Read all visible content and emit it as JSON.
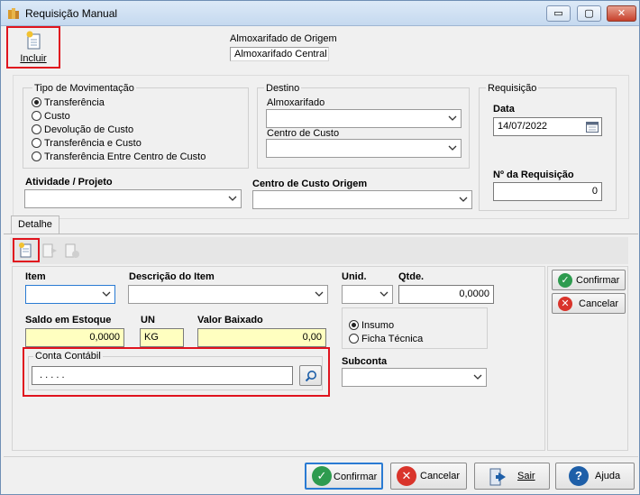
{
  "window": {
    "title": "Requisição Manual",
    "controls": {
      "minimize": "▭",
      "maximize": "▢",
      "close": "✕"
    }
  },
  "toolbar": {
    "incluir_label": "Incluir"
  },
  "origem": {
    "label": "Almoxarifado de Origem",
    "value": "Almoxarifado Central"
  },
  "tipo_movimentacao": {
    "title": "Tipo de Movimentação",
    "options": [
      "Transferência",
      "Custo",
      "Devolução de Custo",
      "Transferência e Custo",
      "Transferência Entre Centro de Custo"
    ],
    "selected": "Transferência"
  },
  "destino": {
    "title": "Destino",
    "almoxarifado_label": "Almoxarifado",
    "centro_custo_label": "Centro de Custo"
  },
  "requisicao": {
    "title": "Requisição",
    "data_label": "Data",
    "data_value": "14/07/2022",
    "numero_label": "Nº  da Requisição",
    "numero_value": "0"
  },
  "atividade_label": "Atividade / Projeto",
  "centro_custo_origem_label": "Centro de Custo Origem",
  "tabs": [
    {
      "label": "Detalhe"
    }
  ],
  "detalhe": {
    "item_label": "Item",
    "descricao_label": "Descrição do Item",
    "unid_label": "Unid.",
    "qtde_label": "Qtde.",
    "qtde_value": "0,0000",
    "saldo_label": "Saldo em Estoque",
    "saldo_value": "0,0000",
    "un_label": "UN",
    "un_value": "KG",
    "valor_baixado_label": "Valor Baixado",
    "valor_baixado_value": "0,00",
    "tipo_options": [
      "Insumo",
      "Ficha Técnica"
    ],
    "tipo_selected": "Insumo",
    "conta_contabil_label": "Conta Contábil",
    "conta_contabil_value": ". . . . .",
    "subconta_label": "Subconta",
    "confirmar_label": "Confirmar",
    "cancelar_label": "Cancelar"
  },
  "footer": {
    "confirmar_label": "Confirmar",
    "cancelar_label": "Cancelar",
    "sair_label": "Sair",
    "ajuda_label": "Ajuda"
  },
  "colors": {
    "highlight": "#e0141e",
    "confirm": "#2e9b4f",
    "cancel": "#d9342b",
    "help": "#1e5fa8",
    "field_yellow": "#ffffc0"
  }
}
